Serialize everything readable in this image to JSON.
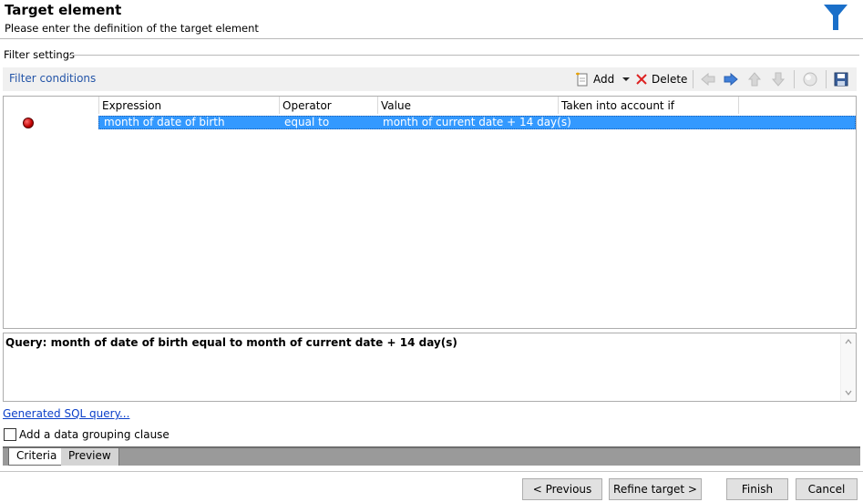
{
  "header": {
    "title": "Target element",
    "subtitle": "Please enter the definition of the target element",
    "icon": "funnel-icon"
  },
  "filter_settings": {
    "label": "Filter settings",
    "conditions_label": "Filter conditions",
    "toolbar": {
      "add_label": "Add",
      "delete_label": "Delete",
      "icons": [
        "add-icon",
        "dropdown-arrow-icon",
        "delete-x-icon",
        "move-left-icon",
        "move-right-icon",
        "move-up-icon",
        "move-down-icon",
        "disable-icon",
        "save-icon"
      ]
    },
    "grid": {
      "columns": [
        "Expression",
        "Operator",
        "Value",
        "Taken into account if"
      ],
      "rows": [
        {
          "status_icon": "red-dot-icon",
          "expression": "month of date of birth",
          "operator": "equal to",
          "value": "month of current date + 14 day(s)",
          "taken_into_account_if": ""
        }
      ]
    }
  },
  "query": {
    "text": "Query: month of date of birth equal to month of current date + 14 day(s)"
  },
  "generated_sql_link": "Generated SQL query...",
  "grouping_checkbox": {
    "label": "Add a data grouping clause",
    "checked": false
  },
  "tabs": [
    {
      "label": "Criteria",
      "active": true
    },
    {
      "label": "Preview",
      "active": false
    }
  ],
  "buttons": {
    "previous": "< Previous",
    "refine": "Refine target >",
    "finish": "Finish",
    "cancel": "Cancel"
  },
  "colors": {
    "accent": "#1a6fc9",
    "selection": "#3399ff",
    "link": "#0b3fc9",
    "conditions_label": "#2455a8"
  }
}
